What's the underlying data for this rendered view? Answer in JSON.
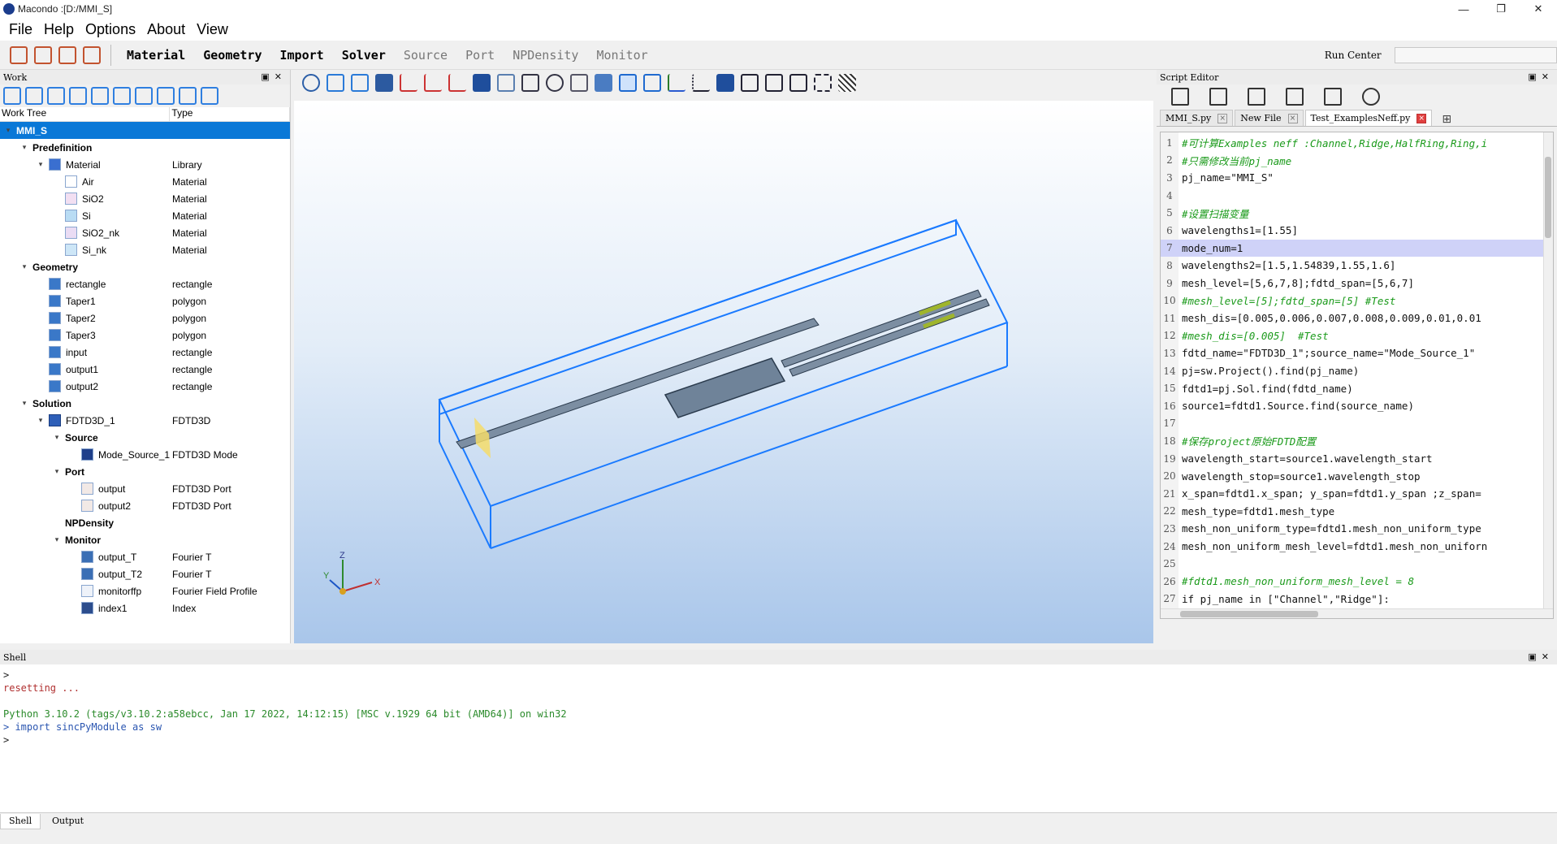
{
  "titlebar": {
    "title": "Macondo :[D:/MMI_S]",
    "minimize": "—",
    "restore": "❐",
    "close": "✕"
  },
  "menu": [
    "File",
    "Help",
    "Options",
    "About",
    "View"
  ],
  "toolbar": {
    "labels": [
      "Material",
      "Geometry",
      "Import",
      "Solver",
      "Source",
      "Port",
      "NPDensity",
      "Monitor"
    ],
    "run_center": "Run Center"
  },
  "work_panel": {
    "title": "Work",
    "col_tree": "Work Tree",
    "col_type": "Type",
    "rows": [
      {
        "name": "MMI_S",
        "type": "",
        "depth": 0,
        "arrow": "▾",
        "bold": true,
        "selected": true,
        "icon": ""
      },
      {
        "name": "Predefinition",
        "type": "",
        "depth": 1,
        "arrow": "▾",
        "bold": true,
        "icon": ""
      },
      {
        "name": "Material",
        "type": "Library",
        "depth": 2,
        "arrow": "▾",
        "icon": "material-library-icon",
        "color": "#3a6fd0"
      },
      {
        "name": "Air",
        "type": "Material",
        "depth": 3,
        "arrow": "",
        "icon": "material-swatch-icon",
        "color": "#ffffff"
      },
      {
        "name": "SiO2",
        "type": "Material",
        "depth": 3,
        "arrow": "",
        "icon": "material-swatch-icon",
        "color": "#f2dff2"
      },
      {
        "name": "Si",
        "type": "Material",
        "depth": 3,
        "arrow": "",
        "icon": "material-swatch-icon",
        "color": "#b9dcf4"
      },
      {
        "name": "SiO2_nk",
        "type": "Material",
        "depth": 3,
        "arrow": "",
        "icon": "material-swatch-icon",
        "color": "#eadcf4"
      },
      {
        "name": "Si_nk",
        "type": "Material",
        "depth": 3,
        "arrow": "",
        "icon": "material-swatch-icon",
        "color": "#cde6f7"
      },
      {
        "name": "Geometry",
        "type": "",
        "depth": 1,
        "arrow": "▾",
        "bold": true,
        "icon": ""
      },
      {
        "name": "rectangle",
        "type": "rectangle",
        "depth": 2,
        "arrow": "",
        "icon": "geometry-icon",
        "color": "#3a78c8"
      },
      {
        "name": "Taper1",
        "type": "polygon",
        "depth": 2,
        "arrow": "",
        "icon": "geometry-icon",
        "color": "#3a78c8"
      },
      {
        "name": "Taper2",
        "type": "polygon",
        "depth": 2,
        "arrow": "",
        "icon": "geometry-icon",
        "color": "#3a78c8"
      },
      {
        "name": "Taper3",
        "type": "polygon",
        "depth": 2,
        "arrow": "",
        "icon": "geometry-icon",
        "color": "#3a78c8"
      },
      {
        "name": "input",
        "type": "rectangle",
        "depth": 2,
        "arrow": "",
        "icon": "geometry-icon",
        "color": "#3a78c8"
      },
      {
        "name": "output1",
        "type": "rectangle",
        "depth": 2,
        "arrow": "",
        "icon": "geometry-icon",
        "color": "#3a78c8"
      },
      {
        "name": "output2",
        "type": "rectangle",
        "depth": 2,
        "arrow": "",
        "icon": "geometry-icon",
        "color": "#3a78c8"
      },
      {
        "name": "Solution",
        "type": "",
        "depth": 1,
        "arrow": "▾",
        "bold": true,
        "icon": ""
      },
      {
        "name": "FDTD3D_1",
        "type": "FDTD3D",
        "depth": 2,
        "arrow": "▾",
        "icon": "fdtd-icon",
        "color": "#2e5fb8",
        "dark": true
      },
      {
        "name": "Source",
        "type": "",
        "depth": 3,
        "arrow": "▾",
        "bold": true,
        "icon": ""
      },
      {
        "name": "Mode_Source_1",
        "type": "FDTD3D Mode",
        "depth": 4,
        "arrow": "",
        "icon": "mode-source-icon",
        "color": "#1f3f8a"
      },
      {
        "name": "Port",
        "type": "",
        "depth": 3,
        "arrow": "▾",
        "bold": true,
        "icon": ""
      },
      {
        "name": "output",
        "type": "FDTD3D Port",
        "depth": 4,
        "arrow": "",
        "icon": "port-icon",
        "color": "#f2e9e6"
      },
      {
        "name": "output2",
        "type": "FDTD3D Port",
        "depth": 4,
        "arrow": "",
        "icon": "port-icon",
        "color": "#f2e9e6"
      },
      {
        "name": "NPDensity",
        "type": "",
        "depth": 3,
        "arrow": "",
        "bold": true,
        "icon": ""
      },
      {
        "name": "Monitor",
        "type": "",
        "depth": 3,
        "arrow": "▾",
        "bold": true,
        "icon": ""
      },
      {
        "name": "output_T",
        "type": "Fourier T",
        "depth": 4,
        "arrow": "",
        "icon": "monitor-icon",
        "color": "#3b6fb5"
      },
      {
        "name": "output_T2",
        "type": "Fourier T",
        "depth": 4,
        "arrow": "",
        "icon": "monitor-icon",
        "color": "#3b6fb5"
      },
      {
        "name": "monitorffp",
        "type": "Fourier Field Profile",
        "depth": 4,
        "arrow": "",
        "icon": "monitor-icon",
        "color": "#eef2f9"
      },
      {
        "name": "index1",
        "type": "Index",
        "depth": 4,
        "arrow": "",
        "icon": "index-icon",
        "color": "#2c4d8d"
      }
    ]
  },
  "viewport": {
    "axis_x": "X",
    "axis_y": "Y",
    "axis_z": "Z"
  },
  "script_editor": {
    "title": "Script Editor",
    "tabs": [
      {
        "label": "MMI_S.py",
        "active": false
      },
      {
        "label": "New File",
        "active": false
      },
      {
        "label": "Test_ExamplesNeff.py",
        "active": true
      }
    ],
    "lines": [
      {
        "n": "1",
        "text": "#可计算Examples neff :Channel,Ridge,HalfRing,Ring,i",
        "comment": true
      },
      {
        "n": "2",
        "text": "#只需修改当前pj_name",
        "comment": true
      },
      {
        "n": "3",
        "text": "pj_name=\"MMI_S\""
      },
      {
        "n": "4",
        "text": ""
      },
      {
        "n": "5",
        "text": "#设置扫描变量",
        "comment": true
      },
      {
        "n": "6",
        "text": "wavelengths1=[1.55]"
      },
      {
        "n": "7",
        "text": "mode_num=1",
        "highlight": true
      },
      {
        "n": "8",
        "text": "wavelengths2=[1.5,1.54839,1.55,1.6]"
      },
      {
        "n": "9",
        "text": "mesh_level=[5,6,7,8];fdtd_span=[5,6,7]"
      },
      {
        "n": "10",
        "text": "#mesh_level=[5];fdtd_span=[5] #Test",
        "comment": true
      },
      {
        "n": "11",
        "text": "mesh_dis=[0.005,0.006,0.007,0.008,0.009,0.01,0.01"
      },
      {
        "n": "12",
        "text": "#mesh_dis=[0.005]  #Test",
        "comment": true
      },
      {
        "n": "13",
        "text": "fdtd_name=\"FDTD3D_1\";source_name=\"Mode_Source_1\""
      },
      {
        "n": "14",
        "text": "pj=sw.Project().find(pj_name)"
      },
      {
        "n": "15",
        "text": "fdtd1=pj.Sol.find(fdtd_name)"
      },
      {
        "n": "16",
        "text": "source1=fdtd1.Source.find(source_name)"
      },
      {
        "n": "17",
        "text": ""
      },
      {
        "n": "18",
        "text": "#保存project原始FDTD配置",
        "comment": true
      },
      {
        "n": "19",
        "text": "wavelength_start=source1.wavelength_start"
      },
      {
        "n": "20",
        "text": "wavelength_stop=source1.wavelength_stop"
      },
      {
        "n": "21",
        "text": "x_span=fdtd1.x_span; y_span=fdtd1.y_span ;z_span="
      },
      {
        "n": "22",
        "text": "mesh_type=fdtd1.mesh_type"
      },
      {
        "n": "23",
        "text": "mesh_non_uniform_type=fdtd1.mesh_non_uniform_type"
      },
      {
        "n": "24",
        "text": "mesh_non_uniform_mesh_level=fdtd1.mesh_non_uniforn"
      },
      {
        "n": "25",
        "text": ""
      },
      {
        "n": "26",
        "text": "#fdtd1.mesh_non_uniform_mesh_level = 8",
        "comment": true
      },
      {
        "n": "27",
        "text": "if pj_name in [\"Channel\",\"Ridge\"]:"
      }
    ]
  },
  "shell": {
    "title": "Shell",
    "lines": [
      {
        "text": ">",
        "color": "#222222"
      },
      {
        "text": "resetting ...",
        "color": "#b03030"
      },
      {
        "text": "",
        "color": "#222222"
      },
      {
        "text": "Python 3.10.2 (tags/v3.10.2:a58ebcc, Jan 17 2022, 14:12:15) [MSC v.1929 64 bit (AMD64)] on win32",
        "color": "#2a8a2a"
      },
      {
        "text": "> import sincPyModule as sw",
        "color": "#2a55b0"
      },
      {
        "text": ">",
        "color": "#222222"
      }
    ]
  },
  "bottom_tabs": [
    {
      "label": "Shell",
      "active": true
    },
    {
      "label": "Output",
      "active": false
    }
  ],
  "colors": {
    "accent": "#0a78d7",
    "box_outline": "#1a7aff",
    "waveguide": "#6f8399",
    "comment_green": "#1a9a1a"
  }
}
